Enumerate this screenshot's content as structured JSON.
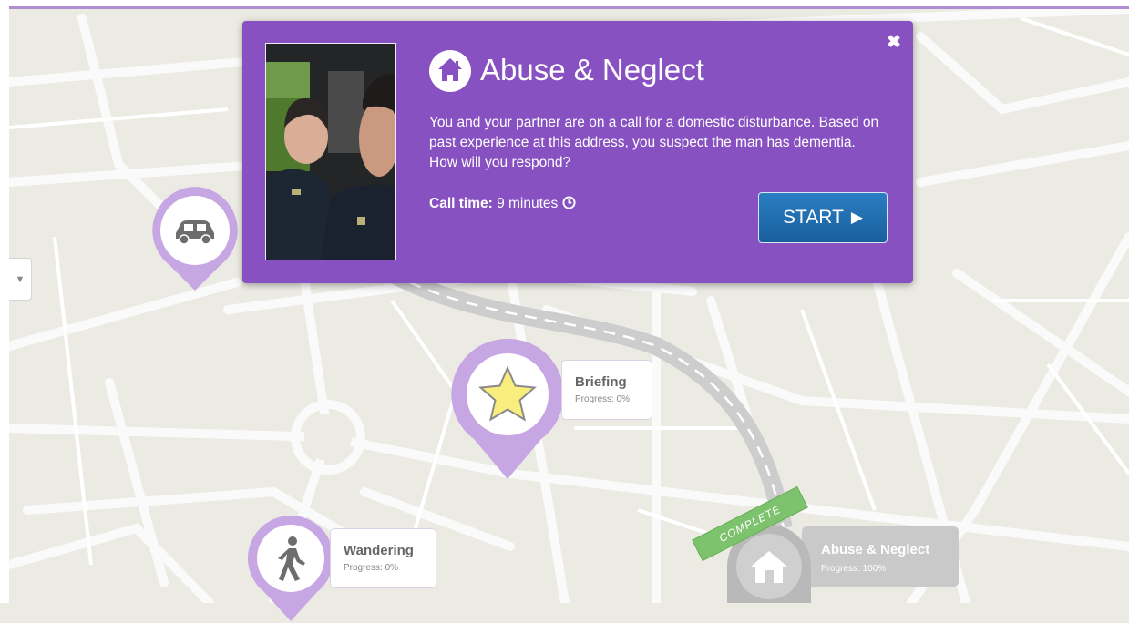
{
  "modal": {
    "title": "Abuse & Neglect",
    "title_icon": "house-icon",
    "description": "You and your partner are on a call for a domestic disturbance. Based on past experience at this address, you suspect the man has dementia. How will you respond?",
    "call_time_label": "Call time:",
    "call_time_value": "9 minutes",
    "call_time_icon": "clock-icon",
    "start_label": "START",
    "start_icon": "play-icon",
    "close_symbol": "✖",
    "photo": "officers-in-patrol-car-photo"
  },
  "markers": [
    {
      "title": "Briefing",
      "progress": "Progress: 0%",
      "icon": "star-icon"
    },
    {
      "title": "Wandering",
      "progress": "Progress: 0%",
      "icon": "walking-person-icon"
    },
    {
      "title": "Abuse & Neglect",
      "progress": "Progress: 100%",
      "icon": "house-icon",
      "badge": "COMPLETE"
    },
    {
      "title": "",
      "icon": "car-icon"
    }
  ],
  "left_toggle": {
    "symbol": "▼"
  },
  "colors": {
    "modal_bg": "#8751c1",
    "marker_purple": "#c7a7e3",
    "start_button": "#1e6eb0",
    "complete_green": "#7dc36e",
    "map_bg": "#ecebe3"
  }
}
